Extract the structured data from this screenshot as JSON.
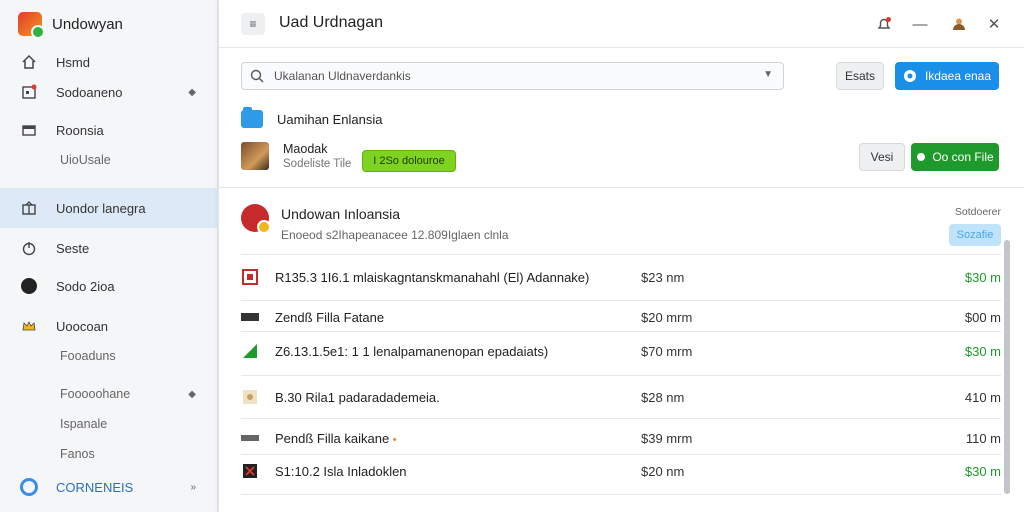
{
  "app": {
    "name": "Undowyan"
  },
  "sidebar": {
    "items": [
      {
        "label": "Hsmd",
        "icon": "home-icon"
      },
      {
        "label": "Sodoaneno",
        "icon": "calendar-icon",
        "trail": "◆"
      },
      {
        "label": "Roonsia",
        "icon": "card-icon"
      },
      {
        "label": "UioUsale"
      },
      {
        "label": "Uondor lanegra",
        "icon": "gift-icon"
      },
      {
        "label": "Seste",
        "icon": "power-icon"
      },
      {
        "label": "Sodo 2ioa",
        "icon": "circle-icon"
      },
      {
        "label": "Uoocoan",
        "icon": "crown-icon"
      },
      {
        "label": "Fooaduns"
      },
      {
        "label": "Fooooohane",
        "trail": "◆"
      },
      {
        "label": "Ispanale"
      },
      {
        "label": "Fanos"
      },
      {
        "label": "CORNENEIS",
        "icon": "ring-icon",
        "trail": "»"
      }
    ]
  },
  "header": {
    "title": "Uad Urdnagan"
  },
  "search": {
    "value": "Ukalanan Uldnaverdankis"
  },
  "toolbar": {
    "gray_label": "Esats",
    "blue_label": "Ikdaea enaa"
  },
  "upload": {
    "folder_label": "Uamihan Enlansia",
    "file_title": "Maodak",
    "file_sub": "Sodeliste Tile",
    "status": "I 2So dolouroe",
    "btn_gray": "Vesi",
    "btn_green": "Oo con File"
  },
  "section": {
    "title": "Undowan Inloansia",
    "subtitle": "Enoeod s2Ihapeanacee 12.809Iglaen clnla",
    "right_label": "Sotdoerer",
    "badge": "Sozafie"
  },
  "rows": [
    {
      "name": "R135.3 1I6.1 mlaiskagntanskmanahahl (El) Adannake)",
      "price": "$23 nm",
      "amount": "$30 m",
      "green": true,
      "icon": "red-square-icon"
    },
    {
      "name": "Zendß Filla Fatane",
      "price": "$20 mrm",
      "amount": "$00 m",
      "green": false,
      "icon": "dark-bar-icon"
    },
    {
      "name": "Z6.13.1.5e1: 1 1 lenalpamanenopan epadaiats)",
      "price": "$70 mrm",
      "amount": "$30 m",
      "green": true,
      "icon": "green-triangle-icon"
    },
    {
      "name": "B.30 Rila1 padaradademeia.",
      "price": "$28 nm",
      "amount": "410 m",
      "green": false,
      "icon": "tan-square-icon"
    },
    {
      "name": "Pendß Filla kaikane",
      "price": "$39 mrm",
      "amount": "110 m",
      "green": false,
      "icon": "gray-bar-icon",
      "note": "•"
    },
    {
      "name": "S1:10.2 Isla Inladoklen",
      "price": "$20 nm",
      "amount": "$30 m",
      "green": true,
      "icon": "red-x-icon"
    }
  ],
  "colors": {
    "accent_blue": "#1a8fe8",
    "accent_green": "#1e9a2c",
    "status_green": "#7ed321"
  }
}
